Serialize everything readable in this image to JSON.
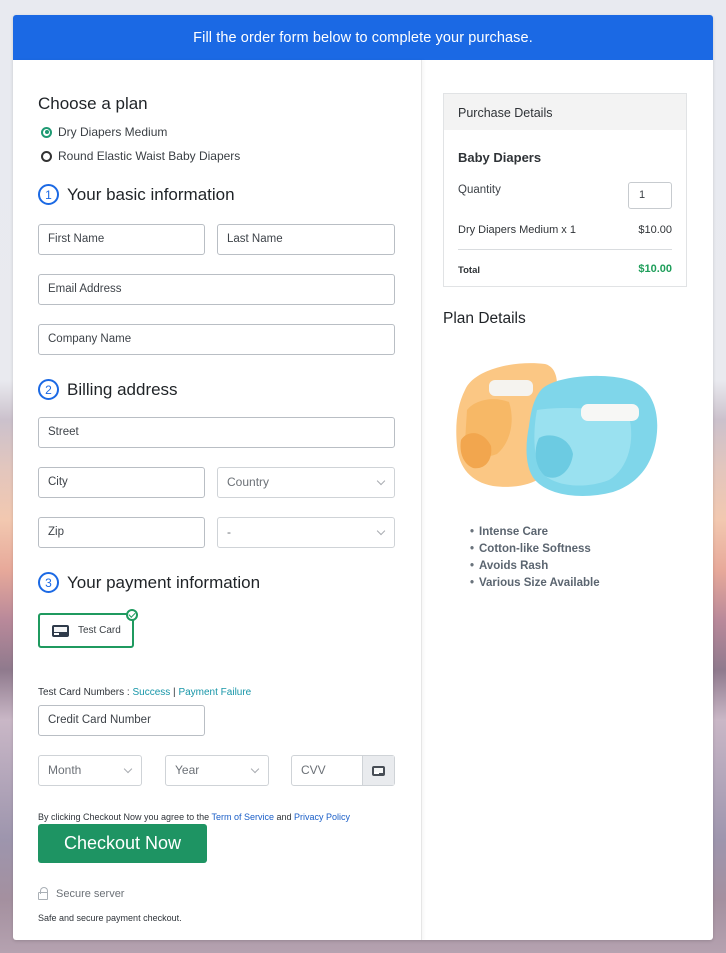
{
  "banner": {
    "text": "Fill the order form below to complete your purchase."
  },
  "plan": {
    "title": "Choose a plan",
    "options": [
      {
        "label": "Dry Diapers Medium",
        "selected": true
      },
      {
        "label": "Round Elastic Waist Baby Diapers",
        "selected": false
      }
    ]
  },
  "basic_info": {
    "number": "1",
    "title": "Your basic information",
    "first_name_placeholder": "First Name",
    "last_name_placeholder": "Last Name",
    "email_placeholder": "Email Address",
    "company_placeholder": "Company Name"
  },
  "billing": {
    "number": "2",
    "title": "Billing address",
    "street_placeholder": "Street",
    "city_placeholder": "City",
    "country_select": "Country",
    "zip_placeholder": "Zip",
    "state_select": "-"
  },
  "payment": {
    "number": "3",
    "title": "Your payment information",
    "card_option_label": "Test Card",
    "test_numbers_label": "Test Card Numbers : ",
    "success_link": "Success",
    "separator": " | ",
    "failure_link": "Payment Failure",
    "card_number_placeholder": "Credit Card Number",
    "month_select": "Month",
    "year_select": "Year",
    "cvv_placeholder": "CVV"
  },
  "agreement": {
    "prefix": "By clicking Checkout Now you agree to the ",
    "terms_link": "Term of Service",
    "and": " and ",
    "privacy_link": "Privacy Policy"
  },
  "checkout": {
    "button_label": "Checkout Now",
    "secure_label": "Secure server",
    "safe_note": "Safe and secure payment checkout."
  },
  "purchase_details": {
    "header": "Purchase Details",
    "product": "Baby Diapers",
    "quantity_label": "Quantity",
    "quantity_value": "1",
    "line_item": "Dry Diapers Medium x 1",
    "line_price": "$10.00",
    "total_label": "Total",
    "total_value": "$10.00",
    "total_color": "#1e9e5a"
  },
  "plan_details": {
    "title": "Plan Details",
    "image_alt": "baby-diapers-image",
    "features": [
      "Intense Care",
      "Cotton-like Softness",
      "Avoids Rash",
      "Various Size Available"
    ]
  },
  "colors": {
    "banner": "#1b69e4",
    "accent_green": "#1e9463",
    "link_teal": "#1796a8",
    "link_blue": "#1b5fc8"
  }
}
